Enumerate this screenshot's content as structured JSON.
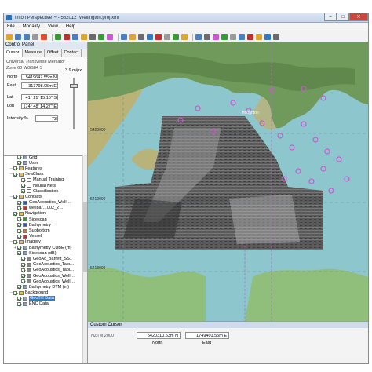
{
  "window": {
    "title": "Triton Perspective™ - 552012_Wellington.proj.xml",
    "min": "–",
    "max": "□",
    "close": "✕"
  },
  "menu": [
    "File",
    "Modality",
    "View",
    "Help"
  ],
  "control_panel": {
    "title": "Control Panel",
    "tabs": [
      "Cursor",
      "Measure",
      "Offset",
      "Contact"
    ],
    "projection": "Universal Transverse Mercator",
    "zone": "Zone 60 WGS84 S",
    "north_label": "North",
    "north_value": "5419647.55m N",
    "east_label": "East",
    "east_value": "313798.05m E",
    "lat_label": "Lat",
    "lat_value": "41° 21' 15.16\" S",
    "lon_label": "Lon",
    "lon_value": "174° 48' 14.27\" E",
    "intensity_label": "Intensity %",
    "intensity_value": "73",
    "zoom": "3.9 m/px"
  },
  "tree": [
    {
      "label": "Grid",
      "indent": 2,
      "exp": "",
      "checked": true,
      "icon": "#8aa0c8"
    },
    {
      "label": "User",
      "indent": 2,
      "exp": "",
      "checked": true,
      "icon": "#8aa0c8"
    },
    {
      "label": "Features",
      "indent": 1,
      "exp": "−",
      "checked": true,
      "icon": "#e6c04a"
    },
    {
      "label": "SeaClass",
      "indent": 1,
      "exp": "−",
      "checked": true,
      "icon": "#e6c04a"
    },
    {
      "label": "Manual Training",
      "indent": 3,
      "exp": "",
      "checked": true,
      "icon": "#ffffff"
    },
    {
      "label": "Neural Nets",
      "indent": 3,
      "exp": "",
      "checked": true,
      "icon": "#ffffff"
    },
    {
      "label": "Classification",
      "indent": 3,
      "exp": "",
      "checked": true,
      "icon": "#ffffff"
    },
    {
      "label": "Contacts",
      "indent": 1,
      "exp": "−",
      "checked": true,
      "icon": "#e6c04a"
    },
    {
      "label": "GeoAcoustics_Well…",
      "indent": 2,
      "exp": "",
      "checked": true,
      "icon": "#2a57b8"
    },
    {
      "label": "wellbar…002_2…",
      "indent": 2,
      "exp": "",
      "checked": true,
      "icon": "#c03030"
    },
    {
      "label": "Navigation",
      "indent": 1,
      "exp": "−",
      "checked": true,
      "icon": "#e6c04a"
    },
    {
      "label": "Sidescan",
      "indent": 2,
      "exp": "",
      "checked": true,
      "icon": "#3a9a3a"
    },
    {
      "label": "Bathymetry",
      "indent": 2,
      "exp": "",
      "checked": true,
      "icon": "#2a57b8"
    },
    {
      "label": "Subbottom",
      "indent": 2,
      "exp": "",
      "checked": true,
      "icon": "#c87b2a"
    },
    {
      "label": "Vessel",
      "indent": 2,
      "exp": "",
      "checked": true,
      "icon": "#c03030"
    },
    {
      "label": "Imagery",
      "indent": 1,
      "exp": "−",
      "checked": true,
      "icon": "#e6c04a"
    },
    {
      "label": "Bathymetry CUBE (m)",
      "indent": 2,
      "exp": "+",
      "checked": true,
      "icon": "#8aa0c8"
    },
    {
      "label": "Sidescan (dB)",
      "indent": 2,
      "exp": "−",
      "checked": true,
      "icon": "#8aa0c8"
    },
    {
      "label": "GeoAc_Barrett_SS1",
      "indent": 3,
      "exp": "",
      "checked": true,
      "icon": "#888888"
    },
    {
      "label": "GeoAcoustics_Tapu…",
      "indent": 3,
      "exp": "",
      "checked": true,
      "icon": "#888888"
    },
    {
      "label": "GeoAcoustics_Tapu…",
      "indent": 3,
      "exp": "",
      "checked": true,
      "icon": "#888888"
    },
    {
      "label": "GeoAcoustics_Well…",
      "indent": 3,
      "exp": "",
      "checked": true,
      "icon": "#888888"
    },
    {
      "label": "GeoAcoustics_Well…",
      "indent": 3,
      "exp": "",
      "checked": true,
      "icon": "#888888"
    },
    {
      "label": "Bathymetry DTM (m)",
      "indent": 2,
      "exp": "",
      "checked": true,
      "icon": "#8aa0c8"
    },
    {
      "label": "Background",
      "indent": 1,
      "exp": "−",
      "checked": true,
      "icon": "#e6c04a"
    },
    {
      "label": "GeoTiff Data",
      "indent": 2,
      "exp": "",
      "checked": true,
      "icon": "#8aa0c8",
      "selected": true
    },
    {
      "label": "ENC Data",
      "indent": 2,
      "exp": "",
      "checked": true,
      "icon": "#8aa0c8"
    }
  ],
  "map": {
    "grid_labels": [
      "5420000",
      "5419000",
      "5418000"
    ],
    "place_label": "Houghton"
  },
  "custom_cursor": {
    "title": "Custom Cursor",
    "zone": "NZTM 2000",
    "north_value": "5420310.53m N",
    "east_value": "1749401.55m E",
    "north_label": "North",
    "east_label": "East"
  },
  "colors": {
    "sea": "#8ec6cd",
    "land": "#8fbf7a",
    "shallows": "#d6b45a",
    "contact": "#c85ad0",
    "accent": "#3178c6"
  }
}
